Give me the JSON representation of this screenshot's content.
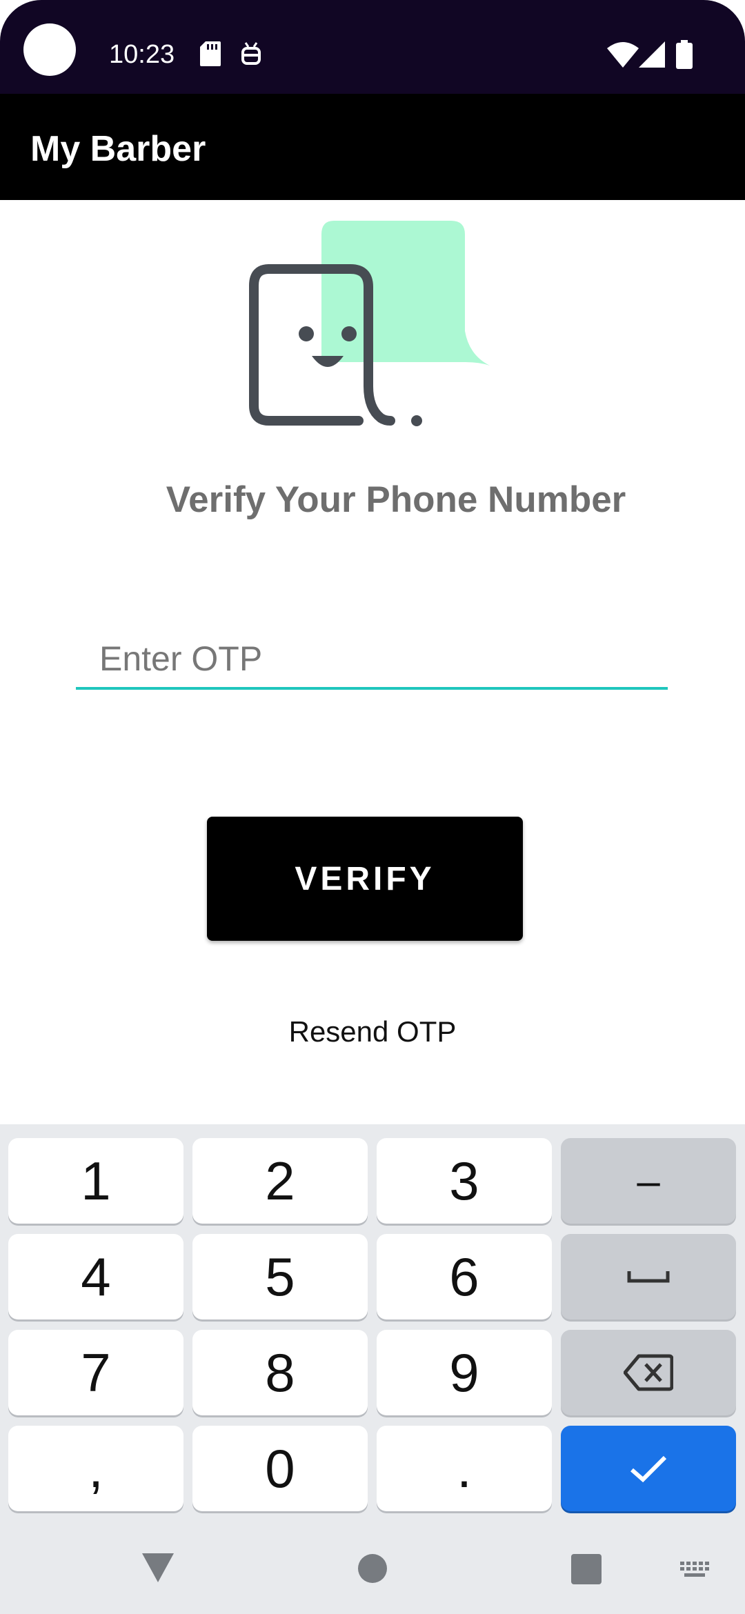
{
  "status_bar": {
    "time": "10:23",
    "icons": [
      "sd-card-icon",
      "android-icon",
      "wifi-icon",
      "signal-icon",
      "battery-icon"
    ],
    "background": "#110624"
  },
  "app_bar": {
    "title": "My Barber",
    "background": "#000000"
  },
  "illustration": {
    "icon": "chat-smiley-icon",
    "bubble_color": "#acf8d3",
    "outline_color": "#474c53"
  },
  "heading": "Verify Your Phone Number",
  "otp": {
    "placeholder": "Enter OTP",
    "value": "",
    "underline_color": "#1fc6bd"
  },
  "verify_button": {
    "label": "VERIFY"
  },
  "resend": {
    "label": "Resend OTP"
  },
  "keyboard": {
    "keys": [
      {
        "label": "1",
        "type": "digit"
      },
      {
        "label": "2",
        "type": "digit"
      },
      {
        "label": "3",
        "type": "digit"
      },
      {
        "label": "–",
        "type": "func"
      },
      {
        "label": "4",
        "type": "digit"
      },
      {
        "label": "5",
        "type": "digit"
      },
      {
        "label": "6",
        "type": "digit"
      },
      {
        "label": "␣",
        "type": "space"
      },
      {
        "label": "7",
        "type": "digit"
      },
      {
        "label": "8",
        "type": "digit"
      },
      {
        "label": "9",
        "type": "digit"
      },
      {
        "label": "⌫",
        "type": "backspace"
      },
      {
        "label": ",",
        "type": "digit"
      },
      {
        "label": "0",
        "type": "digit"
      },
      {
        "label": ".",
        "type": "digit"
      },
      {
        "label": "✓",
        "type": "enter"
      }
    ],
    "enter_color": "#1a73e8"
  },
  "nav_bar": {
    "items": [
      "back-icon",
      "home-icon",
      "recents-icon",
      "keyboard-switch-icon"
    ]
  }
}
